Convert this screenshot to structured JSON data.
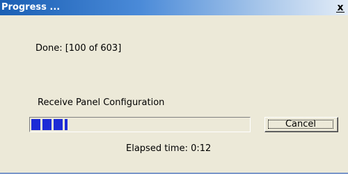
{
  "window": {
    "title": "Progress ...",
    "close_glyph": "x"
  },
  "status": {
    "done_text": "Done: [100 of 603]",
    "task_text": "Receive Panel Configuration",
    "elapsed_text": "Elapsed time: 0:12"
  },
  "progress": {
    "completed": 100,
    "total": 603,
    "fraction": 0.166,
    "fill_color": "#1d2bd6"
  },
  "buttons": {
    "cancel_label": "Cancel"
  },
  "colors": {
    "title_gradient_start": "#1a5fb4",
    "title_gradient_end": "#e3ecf7",
    "dialog_background": "#ece9d8"
  }
}
